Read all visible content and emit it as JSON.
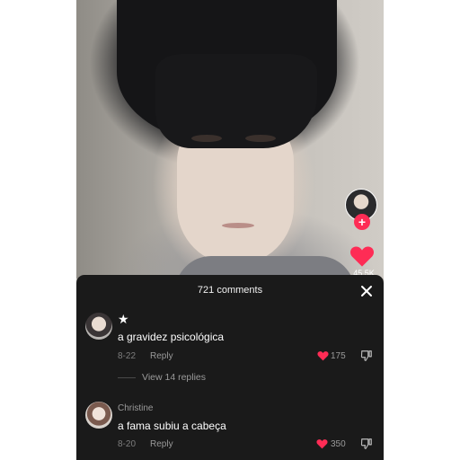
{
  "video": {
    "like_count": "45.5K",
    "follow_symbol": "+"
  },
  "comments_panel": {
    "title": "721 comments",
    "close_icon": "close-icon",
    "comments": [
      {
        "username": "",
        "username_icon": "star-icon",
        "text": "a gravidez psicológica",
        "date": "8-22",
        "reply_label": "Reply",
        "likes": "175",
        "view_replies": "View 14 replies"
      },
      {
        "username": "Christine",
        "text": "a fama subiu a cabeça",
        "date": "8-20",
        "reply_label": "Reply",
        "likes": "350"
      }
    ]
  },
  "colors": {
    "accent_red": "#fe2c55",
    "sheet_bg": "#1a1a1a",
    "muted_text": "#9a9a9a"
  }
}
